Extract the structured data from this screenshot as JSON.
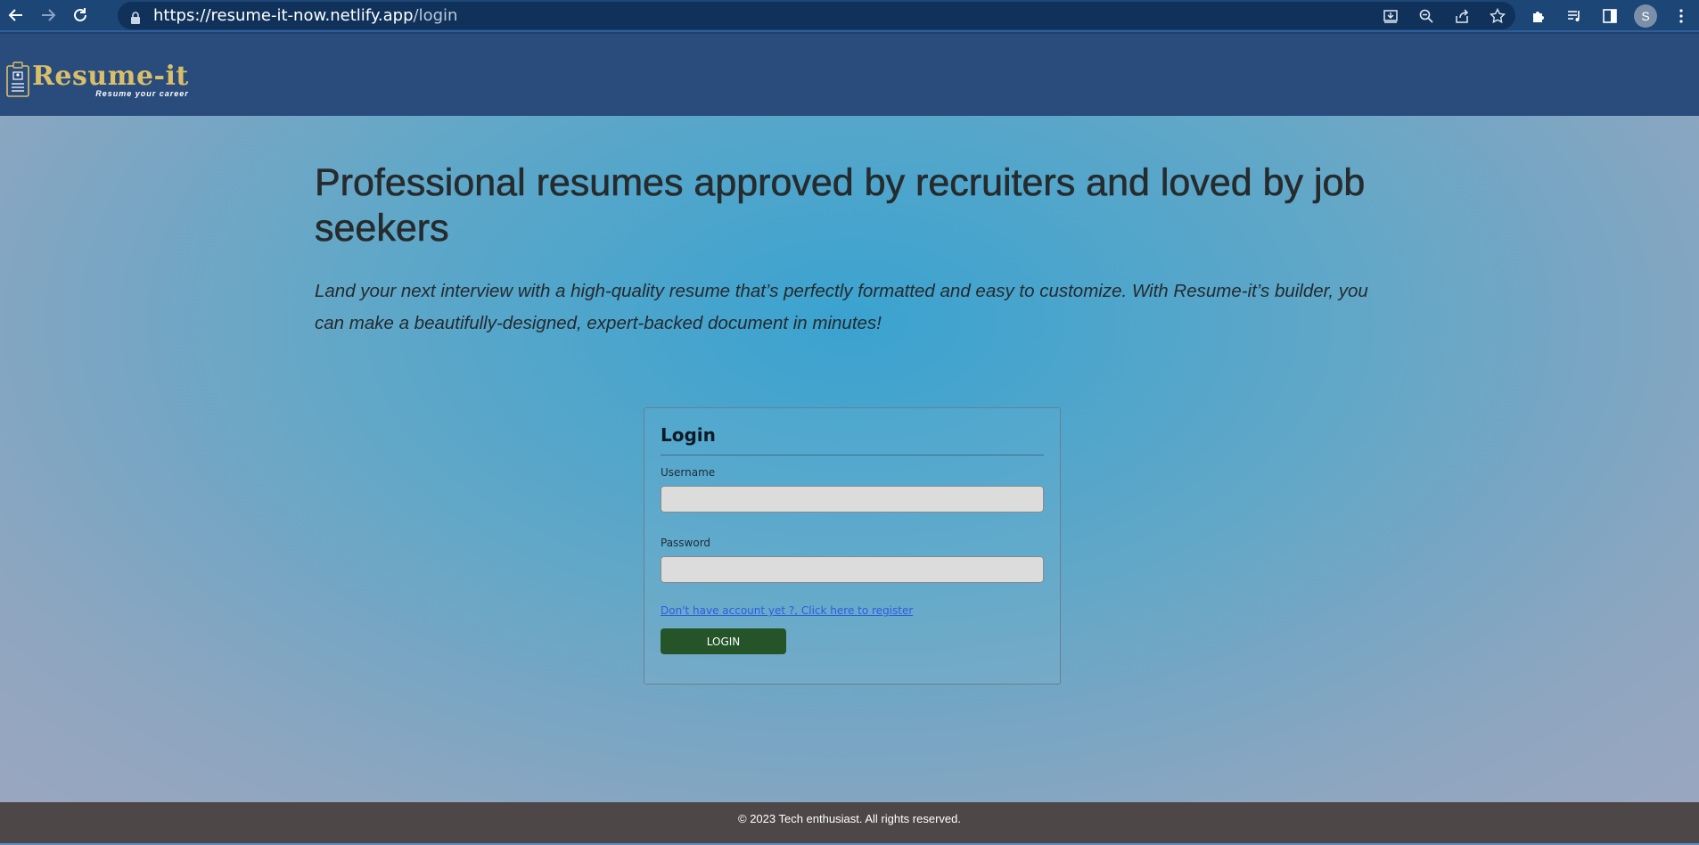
{
  "browser": {
    "url_domain": "https://resume-it-now.netlify.app",
    "url_path": "/login",
    "profile_initial": "S",
    "icons": [
      "back-icon",
      "forward-icon",
      "reload-icon",
      "lock-icon",
      "install-icon",
      "zoom-icon",
      "share-icon",
      "star-icon",
      "extensions-icon",
      "media-icon",
      "side-panel-icon",
      "menu-icon"
    ]
  },
  "header": {
    "logo_title": "Resume-it",
    "logo_tagline": "Resume your career"
  },
  "hero": {
    "title": "Professional resumes approved by recruiters and loved by job seekers",
    "subtitle": "Land your next interview with a high-quality resume that’s perfectly formatted and easy to customize. With Resume-it’s builder, you can make a beautifully-designed, expert-backed document in minutes!"
  },
  "login": {
    "heading": "Login",
    "username_label": "Username",
    "username_value": "",
    "password_label": "Password",
    "password_value": "",
    "register_link": "Don't have account yet ?, Click here to register",
    "submit_label": "LOGIN"
  },
  "footer": {
    "text": "© 2023 Tech enthusiast. All rights reserved."
  },
  "colors": {
    "header_bg": "#2a4c7d",
    "logo_gold": "#d9bf6a",
    "button_green": "#245428",
    "footer_bg": "#4e4748",
    "link_blue": "#2a5de0"
  }
}
